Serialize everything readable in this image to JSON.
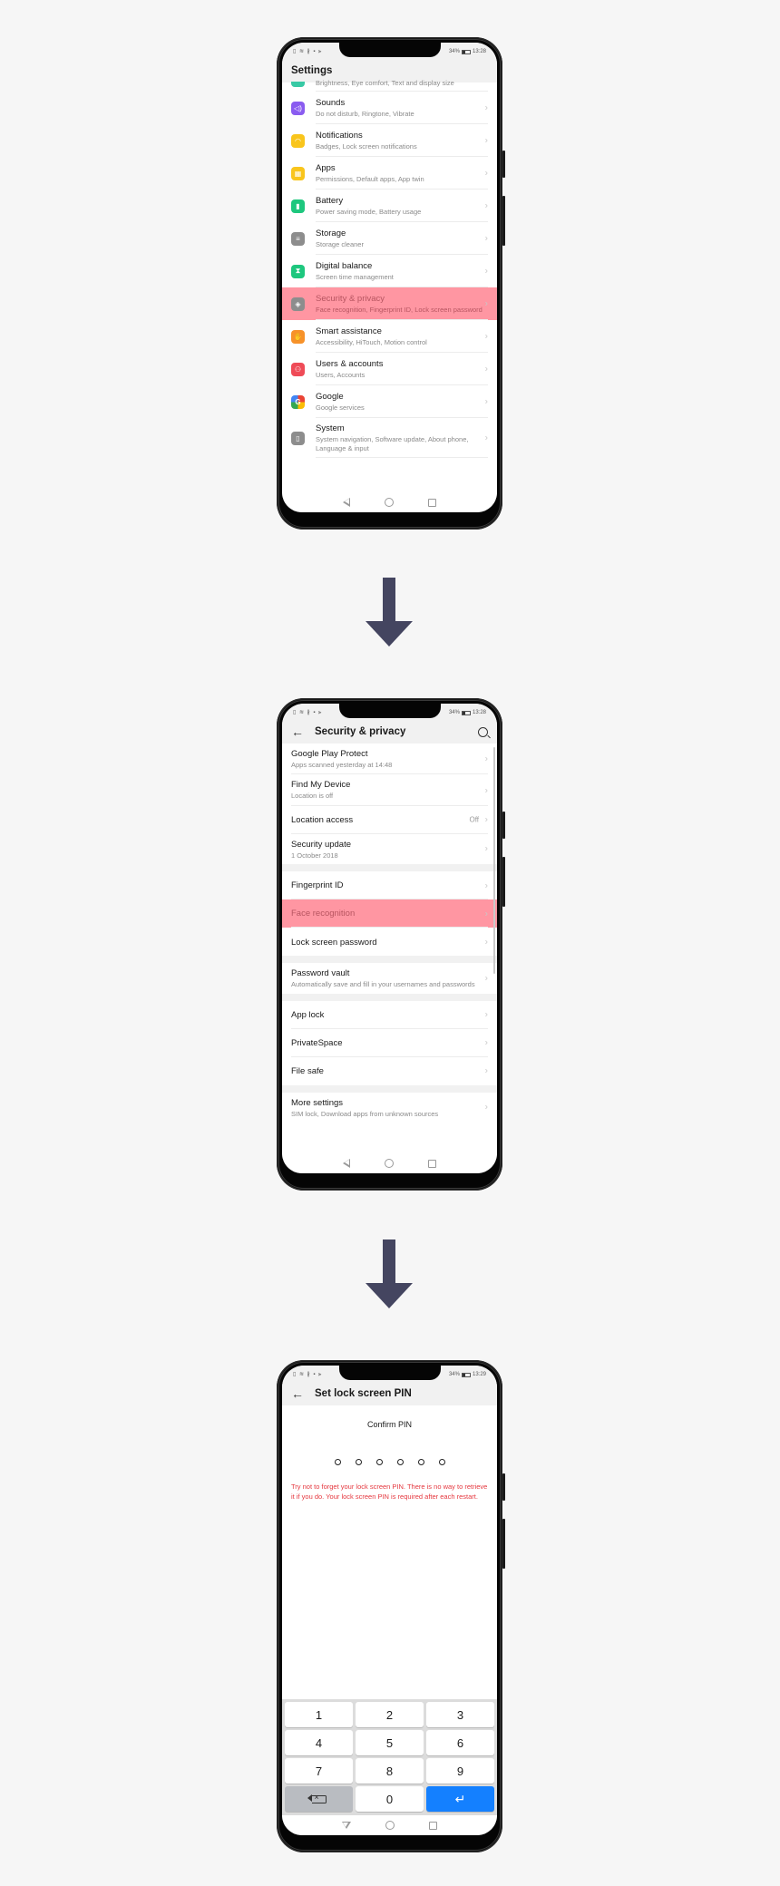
{
  "colors": {
    "highlight": "#ff5064",
    "arrow": "#444560",
    "warning": "#e5373e",
    "enter_key": "#1480ff"
  },
  "status": {
    "icons": "▯ ≋ ∦ ▪ ⪢",
    "battery": "34%",
    "times": [
      "13:28",
      "13:28",
      "13:29"
    ]
  },
  "screen1": {
    "title": "Settings",
    "partial_item_subtitle": "Brightness, Eye comfort, Text and display size",
    "items": [
      {
        "title": "Sounds",
        "subtitle": "Do not disturb, Ringtone, Vibrate",
        "icon": "speaker-icon",
        "color": "#8a5cf0"
      },
      {
        "title": "Notifications",
        "subtitle": "Badges, Lock screen notifications",
        "icon": "bell-icon",
        "color": "#f9c51c"
      },
      {
        "title": "Apps",
        "subtitle": "Permissions, Default apps, App twin",
        "icon": "apps-grid-icon",
        "color": "#f9c51c"
      },
      {
        "title": "Battery",
        "subtitle": "Power saving mode, Battery usage",
        "icon": "battery-icon",
        "color": "#1ec77e"
      },
      {
        "title": "Storage",
        "subtitle": "Storage cleaner",
        "icon": "storage-icon",
        "color": "#8d8d8d"
      },
      {
        "title": "Digital balance",
        "subtitle": "Screen time management",
        "icon": "hourglass-icon",
        "color": "#1ec77e"
      },
      {
        "title": "Security & privacy",
        "subtitle": "Face recognition, Fingerprint ID, Lock screen password",
        "icon": "shield-icon",
        "color": "#8d8d8d",
        "highlighted": true
      },
      {
        "title": "Smart assistance",
        "subtitle": "Accessibility, HiTouch, Motion control",
        "icon": "hand-icon",
        "color": "#f7922a"
      },
      {
        "title": "Users & accounts",
        "subtitle": "Users, Accounts",
        "icon": "user-icon",
        "color": "#ef4b57"
      },
      {
        "title": "Google",
        "subtitle": "Google services",
        "icon": "google-icon",
        "color": "#ffffff"
      },
      {
        "title": "System",
        "subtitle": "System navigation, Software update, About phone, Language & input",
        "icon": "phone-icon",
        "color": "#8d8d8d"
      }
    ]
  },
  "screen2": {
    "back": "←",
    "title": "Security & privacy",
    "groups": [
      [
        {
          "title": "Google Play Protect",
          "subtitle": "Apps scanned yesterday at 14:48"
        },
        {
          "title": "Find My Device",
          "subtitle": "Location is off"
        },
        {
          "title": "Location access",
          "value": "Off"
        },
        {
          "title": "Security update",
          "subtitle": "1 October 2018"
        }
      ],
      [
        {
          "title": "Fingerprint ID"
        },
        {
          "title": "Face recognition",
          "highlighted": true
        },
        {
          "title": "Lock screen password"
        }
      ],
      [
        {
          "title": "Password vault",
          "subtitle": "Automatically save and fill in your usernames and passwords"
        }
      ],
      [
        {
          "title": "App lock"
        },
        {
          "title": "PrivateSpace"
        },
        {
          "title": "File safe"
        }
      ],
      [
        {
          "title": "More settings",
          "subtitle": "SIM lock, Download apps from unknown sources"
        }
      ]
    ]
  },
  "screen3": {
    "back": "←",
    "title": "Set lock screen PIN",
    "subtitle": "Confirm PIN",
    "pin_length": 6,
    "pin_entered": 0,
    "warning": "Try not to forget your lock screen PIN. There is no way to retrieve it if you do. Your lock screen PIN is required after each restart.",
    "keys": [
      "1",
      "2",
      "3",
      "4",
      "5",
      "6",
      "7",
      "8",
      "9",
      "⌫",
      "0",
      "↵"
    ]
  },
  "chevron": "›"
}
